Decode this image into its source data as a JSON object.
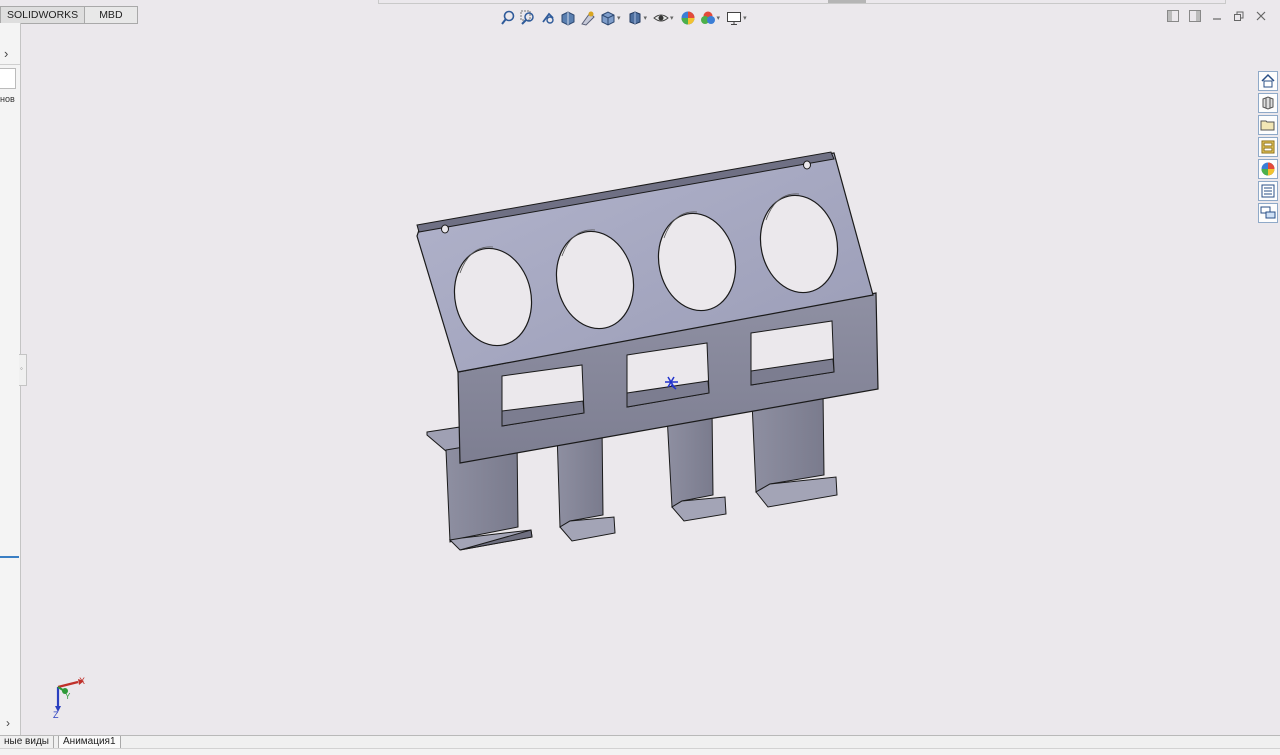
{
  "command_manager": {
    "tabs": [
      {
        "label": "SOLIDWORKS"
      },
      {
        "label": "MBD"
      }
    ]
  },
  "feature_panel": {
    "expand_arrow": "›",
    "partial_label": "нов",
    "collapse_arrow": "›"
  },
  "heads_up_toolbar": {
    "icons": [
      "zoom-to-fit-icon",
      "zoom-to-area-icon",
      "previous-view-icon",
      "section-view-icon",
      "dynamic-annotation-views-icon",
      "view-orientation-icon",
      "display-style-icon",
      "hide-show-items-icon",
      "edit-appearance-icon",
      "apply-scene-icon",
      "view-settings-icon"
    ]
  },
  "task_pane": {
    "icons": [
      "home-icon",
      "design-library-icon",
      "file-explorer-icon",
      "view-palette-icon",
      "appearances-icon",
      "custom-properties-icon",
      "forum-icon"
    ]
  },
  "triad": {
    "x_label": "X",
    "y_label": "Y",
    "z_label": "Z"
  },
  "bottom_tabs": [
    {
      "label": "ные виды"
    },
    {
      "label": "Анимация1"
    }
  ],
  "colors": {
    "viewport_bg": "#ebe8ec",
    "part_top": "#a9abc4",
    "part_side": "#8b8ca0",
    "part_edge": "#1a1a1a",
    "accent_blue": "#3a7fc4"
  }
}
